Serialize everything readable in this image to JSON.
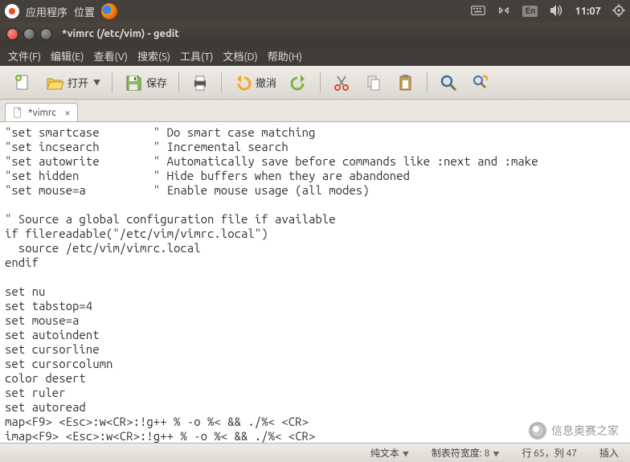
{
  "top_panel": {
    "apps": "应用程序",
    "places": "位置",
    "lang_badge": "En",
    "clock": "11:07"
  },
  "window": {
    "title": "*vimrc (/etc/vim) - gedit"
  },
  "menu": {
    "file": "文件(F)",
    "edit": "编辑(E)",
    "view": "查看(V)",
    "search": "搜索(S)",
    "tools": "工具(T)",
    "documents": "文档(D)",
    "help": "帮助(H)"
  },
  "toolbar": {
    "open": "打开",
    "save": "保存",
    "undo": "撤消"
  },
  "tab": {
    "label": "*vimrc"
  },
  "editor_text": "\"set smartcase        \" Do smart case matching\n\"set incsearch        \" Incremental search\n\"set autowrite        \" Automatically save before commands like :next and :make\n\"set hidden           \" Hide buffers when they are abandoned\n\"set mouse=a          \" Enable mouse usage (all modes)\n\n\" Source a global configuration file if available\nif filereadable(\"/etc/vim/vimrc.local\")\n  source /etc/vim/vimrc.local\nendif\n\nset nu\nset tabstop=4\nset mouse=a\nset autoindent\nset cursorline\nset cursorcolumn\ncolor desert\nset ruler\nset autoread\nmap<F9> <Esc>:w<CR>:!g++ % -o %< && ./%< <CR>\nimap<F9> <Esc>:w<CR>:!g++ % -o %< && ./%< <CR>",
  "status": {
    "plain_text": "纯文本",
    "tab_width_label": "制表符宽度:",
    "tab_width_value": "8",
    "line_col": "行 65，列 47",
    "mode": "插入"
  },
  "watermark": "信息奥赛之家"
}
